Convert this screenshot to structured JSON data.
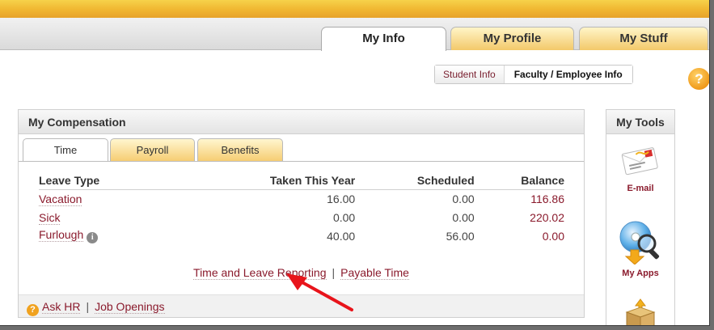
{
  "main_tabs": [
    {
      "label": "My Info",
      "active": true
    },
    {
      "label": "My Profile",
      "active": false
    },
    {
      "label": "My Stuff",
      "active": false
    }
  ],
  "sub_tabs": [
    {
      "label": "Student Info",
      "active": false
    },
    {
      "label": "Faculty / Employee Info",
      "active": true
    }
  ],
  "help_icon": "question-mark-icon",
  "compensation": {
    "title": "My Compensation",
    "tabs": [
      {
        "label": "Time",
        "active": true
      },
      {
        "label": "Payroll",
        "active": false
      },
      {
        "label": "Benefits",
        "active": false
      }
    ],
    "table": {
      "headers": [
        "Leave Type",
        "Taken This Year",
        "Scheduled",
        "Balance"
      ],
      "rows": [
        {
          "type": "Vacation",
          "taken": "16.00",
          "scheduled": "0.00",
          "balance": "116.86"
        },
        {
          "type": "Sick",
          "taken": "0.00",
          "scheduled": "0.00",
          "balance": "220.02"
        },
        {
          "type": "Furlough",
          "taken": "40.00",
          "scheduled": "56.00",
          "balance": "0.00"
        }
      ]
    },
    "links": {
      "time_leave": "Time and Leave Reporting",
      "separator": "|",
      "payable": "Payable Time"
    },
    "footer": {
      "ask_hr": "Ask HR",
      "separator": "|",
      "jobs": "Job Openings"
    }
  },
  "tools": {
    "title": "My Tools",
    "items": [
      {
        "label": "E-mail",
        "icon": "envelope-icon"
      },
      {
        "label": "My Apps",
        "icon": "cd-magnifier-icon"
      },
      {
        "label": "",
        "icon": "box-icon"
      }
    ]
  },
  "colors": {
    "accent": "#8a1a2c",
    "topbar": "#f0b631",
    "annotation_arrow": "#e8141b"
  }
}
